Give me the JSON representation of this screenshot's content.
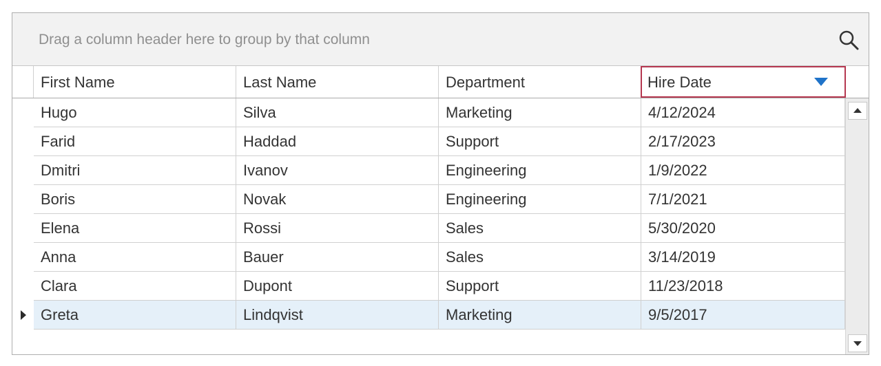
{
  "group_panel": {
    "hint": "Drag a column header here to group by that column",
    "search_icon": "search-icon"
  },
  "columns": [
    {
      "label": "First Name"
    },
    {
      "label": "Last Name"
    },
    {
      "label": "Department"
    },
    {
      "label": "Hire Date",
      "sorted": "descending"
    }
  ],
  "rows": [
    [
      "Hugo",
      "Silva",
      "Marketing",
      "4/12/2024"
    ],
    [
      "Farid",
      "Haddad",
      "Support",
      "2/17/2023"
    ],
    [
      "Dmitri",
      "Ivanov",
      "Engineering",
      "1/9/2022"
    ],
    [
      "Boris",
      "Novak",
      "Engineering",
      "7/1/2021"
    ],
    [
      "Elena",
      "Rossi",
      "Sales",
      "5/30/2020"
    ],
    [
      "Anna",
      "Bauer",
      "Sales",
      "3/14/2019"
    ],
    [
      "Clara",
      "Dupont",
      "Support",
      "11/23/2018"
    ],
    [
      "Greta",
      "Lindqvist",
      "Marketing",
      "9/5/2017"
    ]
  ],
  "current_row_index": 7,
  "colors": {
    "accent": "#1f73c9",
    "sorted_header_border": "#b5374f",
    "selected_row": "#e5f0f9"
  }
}
